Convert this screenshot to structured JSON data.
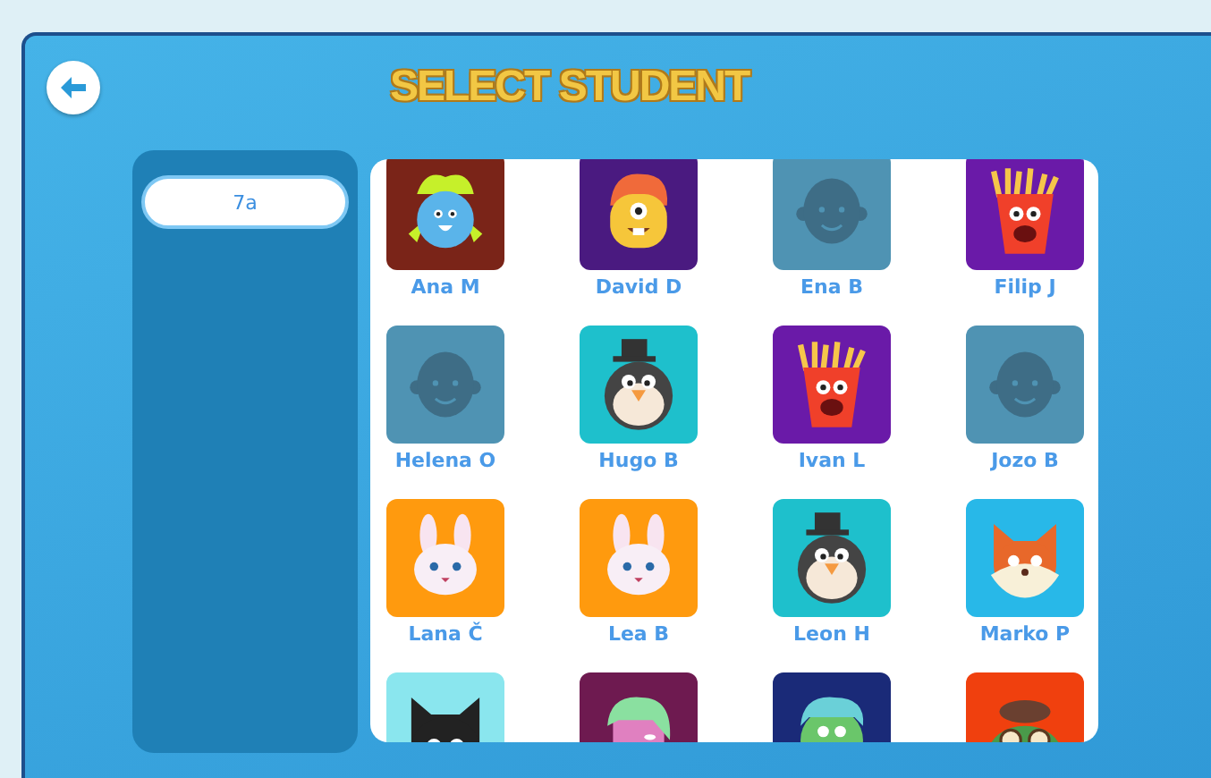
{
  "title": "SELECT STUDENT",
  "classes": [
    {
      "label": "7a",
      "selected": true
    }
  ],
  "students": [
    {
      "name": "Ana M",
      "kind": "blob",
      "color": "#7a2418"
    },
    {
      "name": "David D",
      "kind": "cyclops",
      "color": "#4a1a80"
    },
    {
      "name": "Ena B",
      "kind": "placeholder",
      "color": "#4f93b3"
    },
    {
      "name": "Filip J",
      "kind": "fries",
      "color": "#6a1aa8"
    },
    {
      "name": "Helena O",
      "kind": "placeholder",
      "color": "#4f93b3"
    },
    {
      "name": "Hugo B",
      "kind": "penguin",
      "color": "#1ec0cc"
    },
    {
      "name": "Ivan L",
      "kind": "fries",
      "color": "#6a1aa8"
    },
    {
      "name": "Jozo B",
      "kind": "placeholder",
      "color": "#4f93b3"
    },
    {
      "name": "Lana Č",
      "kind": "bunny",
      "color": "#ff9a0e"
    },
    {
      "name": "Lea B",
      "kind": "bunny",
      "color": "#ff9a0e"
    },
    {
      "name": "Leon H",
      "kind": "penguin",
      "color": "#1ec0cc"
    },
    {
      "name": "Marko P",
      "kind": "fox",
      "color": "#28b8e8"
    },
    {
      "kind": "cat",
      "color": "#8ae6ee"
    },
    {
      "kind": "girl",
      "color": "#6e1a50"
    },
    {
      "kind": "green-kid",
      "color": "#1a2a78"
    },
    {
      "kind": "frog",
      "color": "#f0400e"
    }
  ]
}
